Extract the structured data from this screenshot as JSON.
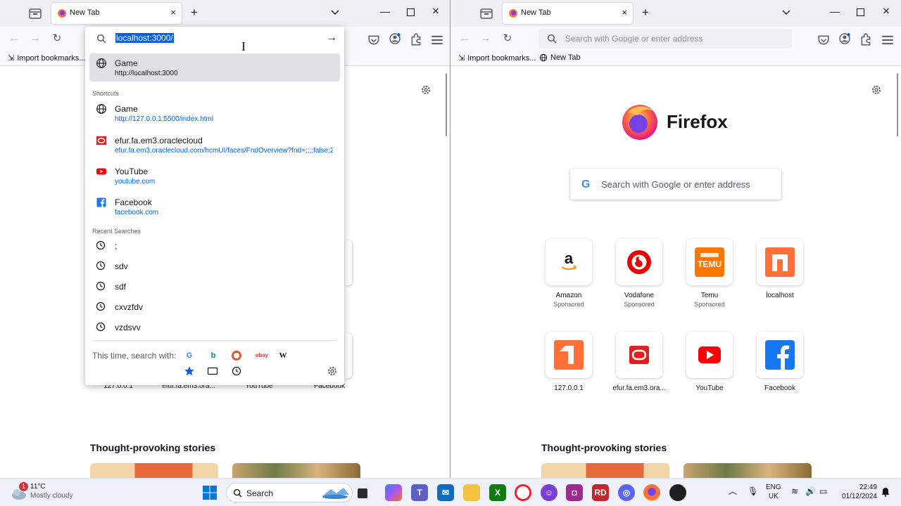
{
  "left_window": {
    "tab_title": "New Tab",
    "bookmarks_import": "Import bookmarks...",
    "url_value": "localhost:3000/",
    "dropdown": {
      "top_result": {
        "title": "Game",
        "url": "http://localhost:3000"
      },
      "shortcuts_header": "Shortcuts",
      "shortcuts": [
        {
          "title": "Game",
          "url": "http://127.0.0.1:5500/index.html",
          "icon": "globe-icon"
        },
        {
          "title": "efur.fa.em3.oraclecloud",
          "url": "efur.fa.em3.oraclecloud.com/hcmUI/faces/FndOverview?fnd=;;;;false;256",
          "icon": "oracle-icon"
        },
        {
          "title": "YouTube",
          "url": "youtube.com",
          "icon": "youtube-icon"
        },
        {
          "title": "Facebook",
          "url": "facebook.com",
          "icon": "facebook-icon"
        }
      ],
      "recent_header": "Recent Searches",
      "recent": [
        ";",
        "sdv",
        "sdf",
        "cxvzfdv",
        "vzdsvv"
      ],
      "search_with": "This time, search with:",
      "engines": [
        "google",
        "bing",
        "duckduckgo",
        "ebay",
        "wikipedia"
      ]
    },
    "tiles_below": [
      "127.0.0.1",
      "efur.fa.em3.ora...",
      "YouTube",
      "Facebook"
    ],
    "stories_title": "Thought-provoking stories"
  },
  "right_window": {
    "tab_title": "New Tab",
    "url_placeholder": "Search with Google or enter address",
    "bookmarks_import": "Import bookmarks...",
    "bookmarks_newtab": "New Tab",
    "brand": "Firefox",
    "search_placeholder": "Search with Google or enter address",
    "tiles_row1": [
      {
        "label": "Amazon",
        "sub": "Sponsored"
      },
      {
        "label": "Vodafone",
        "sub": "Sponsored"
      },
      {
        "label": "Temu",
        "sub": "Sponsored"
      },
      {
        "label": "localhost",
        "sub": ""
      }
    ],
    "tiles_row2": [
      {
        "label": "127.0.0.1"
      },
      {
        "label": "efur.fa.em3.ora..."
      },
      {
        "label": "YouTube"
      },
      {
        "label": "Facebook"
      }
    ],
    "stories_title": "Thought-provoking stories"
  },
  "taskbar": {
    "weather_temp": "11°C",
    "weather_desc": "Mostly cloudy",
    "weather_badge": "1",
    "search_label": "Search",
    "lang1": "ENG",
    "lang2": "UK",
    "time": "22:49",
    "date": "01/12/2024"
  },
  "colors": {
    "accent": "#0061e0",
    "youtube": "#ff0000",
    "facebook": "#1877f2",
    "oracle": "#e02020"
  }
}
